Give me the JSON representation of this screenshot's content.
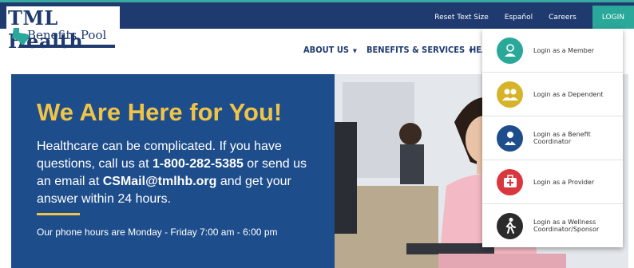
{
  "logo": {
    "line1": "TML Health",
    "line2": "Benefits Pool"
  },
  "utility": {
    "reset_text_size": "Reset Text Size",
    "espanol": "Español",
    "careers": "Careers",
    "login": "LOGIN"
  },
  "nav": {
    "about_us": "ABOUT US",
    "benefits_services": "BENEFITS & SERVICES",
    "partial": "HEA"
  },
  "hero": {
    "title": "We Are Here for You!",
    "text1": "Healthcare can be complicated. If you have questions, call us at ",
    "phone": "1-800-282-5385",
    "text2": " or send us an email at ",
    "email": "CSMail@tmlhb.org",
    "text3": " and get your answer within 24 hours.",
    "hours": "Our phone hours are Monday - Friday 7:00 am - 6:00 pm"
  },
  "login_menu": {
    "items": [
      {
        "label": "Login as a Member",
        "color": "#2aa89a",
        "icon": "member-icon"
      },
      {
        "label": "Login as a Dependent",
        "color": "#d6b42a",
        "icon": "dependent-icon"
      },
      {
        "label": "Login as a Benefit Coordinator",
        "color": "#1e4d8c",
        "icon": "coordinator-icon"
      },
      {
        "label": "Login as a Provider",
        "color": "#d9363e",
        "icon": "provider-icon"
      },
      {
        "label": "Login as a Wellness Coordinator/Sponsor",
        "color": "#2b2b2b",
        "icon": "wellness-icon"
      }
    ]
  },
  "colors": {
    "navy": "#1e3a6f",
    "hero_blue": "#1e4d8c",
    "gold": "#f0c447",
    "teal": "#2aa89a"
  }
}
